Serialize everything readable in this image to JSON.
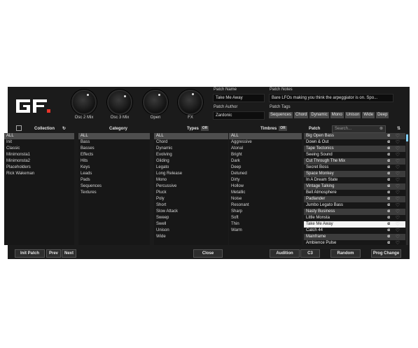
{
  "knobs": [
    {
      "label": "Osc 2 Mix"
    },
    {
      "label": "Osc 3 Mix"
    },
    {
      "label": "Open"
    },
    {
      "label": "FX"
    }
  ],
  "patch_name": {
    "label": "Patch Name",
    "value": "Take Me Away"
  },
  "patch_author": {
    "label": "Patch Author",
    "value": "Zardonic"
  },
  "patch_notes": {
    "label": "Patch Notes",
    "value": "Bare LFOs making you think the arpeggiator is on. Spo..."
  },
  "patch_tags": {
    "label": "Patch Tags",
    "items": [
      "Sequences",
      "Chord",
      "Dynamic",
      "Mono",
      "Unison",
      "Wide",
      "Deep"
    ]
  },
  "headers": {
    "collection": "Collection",
    "category": "Category",
    "types": "Types",
    "types_toggle": "OR",
    "timbres": "Timbres",
    "timbres_toggle": "OR",
    "patch": "Patch"
  },
  "search": {
    "placeholder": "Search..."
  },
  "collection": [
    "ALL",
    "Init",
    "Classic",
    "Minimonsta1",
    "Minimonsta2",
    "Placeholders",
    "Rick Wakeman"
  ],
  "category": [
    "ALL",
    "Bass",
    "Basses",
    "Effects",
    "Hits",
    "Keys",
    "Leads",
    "Pads",
    "Sequences",
    "Textures"
  ],
  "types": [
    "ALL",
    "Chord",
    "Dynamic",
    "Evolving",
    "Gliding",
    "Legato",
    "Long Release",
    "Mono",
    "Percussive",
    "Pluck",
    "Poly",
    "Short",
    "Slow Attack",
    "Sweep",
    "Swell",
    "Unison",
    "Wide"
  ],
  "timbres": [
    "ALL",
    "Aggressive",
    "Atonal",
    "Bright",
    "Dark",
    "Deep",
    "Detuned",
    "Dirty",
    "Hollow",
    "Metallic",
    "Noise",
    "Resonant",
    "Sharp",
    "Soft",
    "Thin",
    "Warm"
  ],
  "patches": [
    "Big Open Bass",
    "Down & Out",
    "Tape Tectonics",
    "Seeing Sound",
    "Cut Through The Mix",
    "Secret Boss",
    "Space Monkey",
    "In A Dream State",
    "Vintage Talking",
    "Bell Atmosphere",
    "Padlander",
    "Jumbo Legato Bass",
    "Nasty Business",
    "Little Monsta",
    "Take Me Away",
    "Catch 44",
    "Mainframe",
    "Ambience Pulse"
  ],
  "current_patch": "Take Me Away",
  "buttons": {
    "init_patch": "Init Patch",
    "prev": "Prev",
    "next": "Next",
    "close": "Close",
    "audition": "Audition",
    "note": "C3",
    "random": "Random",
    "prog_change": "Prog Change"
  },
  "colors": {
    "logo_accent": "#e8352a",
    "background": "#1b1b1b",
    "selected_row": "#f4f4f4"
  }
}
